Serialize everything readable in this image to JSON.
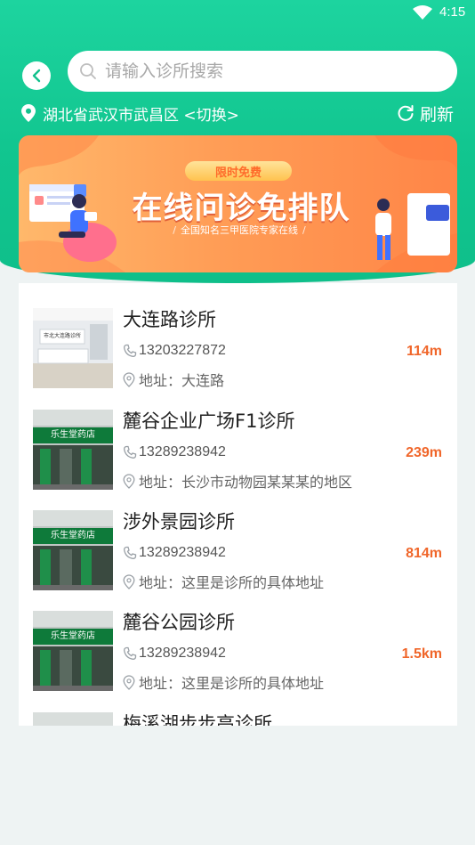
{
  "status": {
    "time": "4:15"
  },
  "search": {
    "placeholder": "请输入诊所搜索"
  },
  "location": {
    "text": "湖北省武汉市武昌区 <切换>",
    "refresh_label": "刷新"
  },
  "banner": {
    "badge": "限时免费",
    "title": "在线问诊免排队",
    "subtitle": "全国知名三甲医院专家在线"
  },
  "clinics": [
    {
      "name": "大连路诊所",
      "phone": "13203227872",
      "distance": "114m",
      "address": "地址：大连路",
      "thumb": "clinic-interior",
      "thumb_text": "市北大连路诊所"
    },
    {
      "name": "麓谷企业广场F1诊所",
      "phone": "13289238942",
      "distance": "239m",
      "address": "地址：长沙市动物园某某某的地区",
      "thumb": "pharmacy-storefront",
      "thumb_text": "乐生堂药店"
    },
    {
      "name": "涉外景园诊所",
      "phone": "13289238942",
      "distance": "814m",
      "address": "地址：这里是诊所的具体地址",
      "thumb": "pharmacy-storefront",
      "thumb_text": "乐生堂药店"
    },
    {
      "name": "麓谷公园诊所",
      "phone": "13289238942",
      "distance": "1.5km",
      "address": "地址：这里是诊所的具体地址",
      "thumb": "pharmacy-storefront",
      "thumb_text": "乐生堂药店"
    },
    {
      "name": "梅溪湖步步高诊所",
      "thumb": "pharmacy-storefront"
    }
  ],
  "colors": {
    "primary": "#11c58f",
    "distance": "#f0662a",
    "banner": "#ff9d56"
  }
}
